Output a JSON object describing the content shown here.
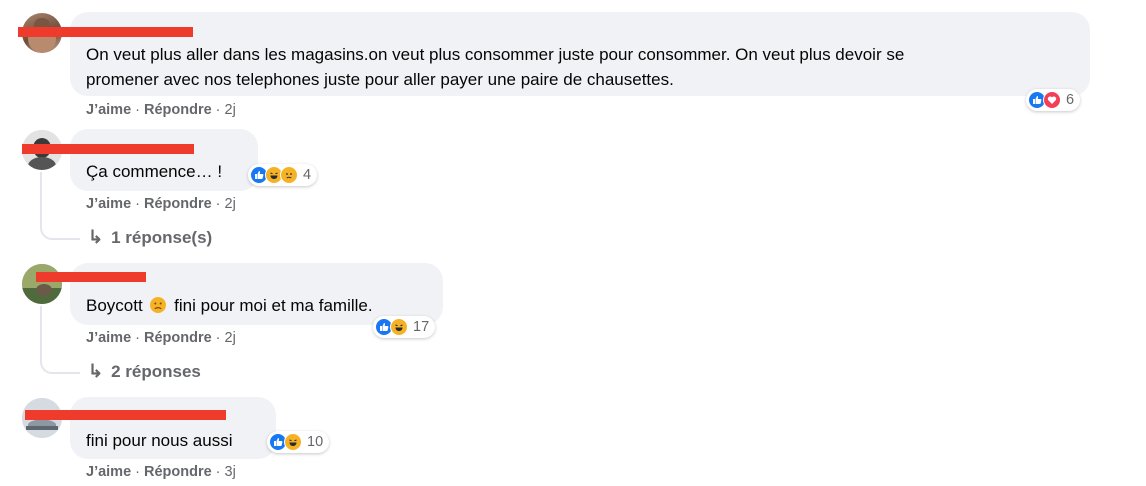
{
  "comments": [
    {
      "text_lines": [
        "On veut plus aller dans les magasins.on veut plus consommer juste pour consommer. On veut plus devoir se",
        "promener avec nos telephones juste pour aller payer une paire de chausettes."
      ],
      "like_label": "J’aime",
      "reply_label": "Répondre",
      "time": "2j",
      "reactions": [
        "like-icon",
        "love-icon"
      ],
      "reaction_count": "6"
    },
    {
      "text": "Ça commence… !",
      "like_label": "J’aime",
      "reply_label": "Répondre",
      "time": "2j",
      "reactions": [
        "like-icon",
        "haha-icon",
        "sad-icon"
      ],
      "reaction_count": "4",
      "replies_label": "1 réponse(s)"
    },
    {
      "text_before": "Boycott",
      "inline_emoji": "sad-face-emoji",
      "text_after": "fini pour moi et ma famille.",
      "like_label": "J’aime",
      "reply_label": "Répondre",
      "time": "2j",
      "reactions": [
        "like-icon",
        "haha-icon"
      ],
      "reaction_count": "17",
      "replies_label": "2 réponses"
    },
    {
      "text": "fini pour nous aussi",
      "like_label": "J’aime",
      "reply_label": "Répondre",
      "time": "3j",
      "reactions": [
        "like-icon",
        "haha-icon"
      ],
      "reaction_count": "10"
    }
  ],
  "colors": {
    "bubble": "#f0f2f5",
    "meta_text": "#65676b",
    "redaction": "#ee3b2c",
    "like_blue": "#1877f2",
    "love_red": "#f33e58",
    "haha_yellow": "#f7b125"
  }
}
